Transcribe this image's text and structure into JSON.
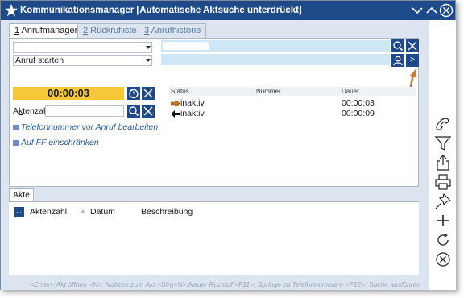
{
  "window": {
    "title": "Kommunikationsmanager [Automatische Aktsuche unterdrückt]",
    "title_bar_color": "#1e4a8a",
    "icons": [
      "star-icon",
      "minimize-icon",
      "maximize-icon",
      "close-icon"
    ]
  },
  "tabs": [
    {
      "num": "1",
      "label": " Anrufmanager",
      "active": true
    },
    {
      "num": "2",
      "label": " Rückrufliste",
      "active": false
    },
    {
      "num": "3",
      "label": " Anrufhistorie",
      "active": false
    }
  ],
  "caller_select": {
    "value": ""
  },
  "action_select": {
    "value": "Anruf starten"
  },
  "timer": {
    "value": "00:00:03",
    "color": "#f5c83a"
  },
  "aktenzahl": {
    "label_accel": "k",
    "label_pre": "A",
    "label_post": "tenzahl:",
    "value": ""
  },
  "links": [
    {
      "label": "Telefonnummer vor Anruf bearbeiten"
    },
    {
      "label": "Auf FF einschränken"
    }
  ],
  "right_search": {
    "value": ""
  },
  "right_next_label": ">",
  "call_table": {
    "headers": [
      "Status",
      "Nummer",
      "Dauer"
    ],
    "rows": [
      {
        "direction": "outgoing",
        "status": "inaktiv",
        "number": "",
        "duration": "00:00:03"
      },
      {
        "direction": "incoming",
        "status": "inaktiv",
        "number": "",
        "duration": "00:00:09"
      }
    ]
  },
  "akte": {
    "tab_label": "Akte",
    "button_label": "...",
    "columns": [
      "Aktenzahl",
      "Datum",
      "Beschreibung"
    ]
  },
  "sidebar_icons": [
    "phone-icon",
    "filter-icon",
    "share-icon",
    "print-icon",
    "pin-icon",
    "plus-icon",
    "refresh-icon",
    "cancel-icon"
  ],
  "hint": "<Enter>:Akt öffnen <N>: Notizen zum Akt <Strg+N>:Neuer Rückruf <F11>: Springe zu Telefonnummern <F12>: Suche ausführen"
}
